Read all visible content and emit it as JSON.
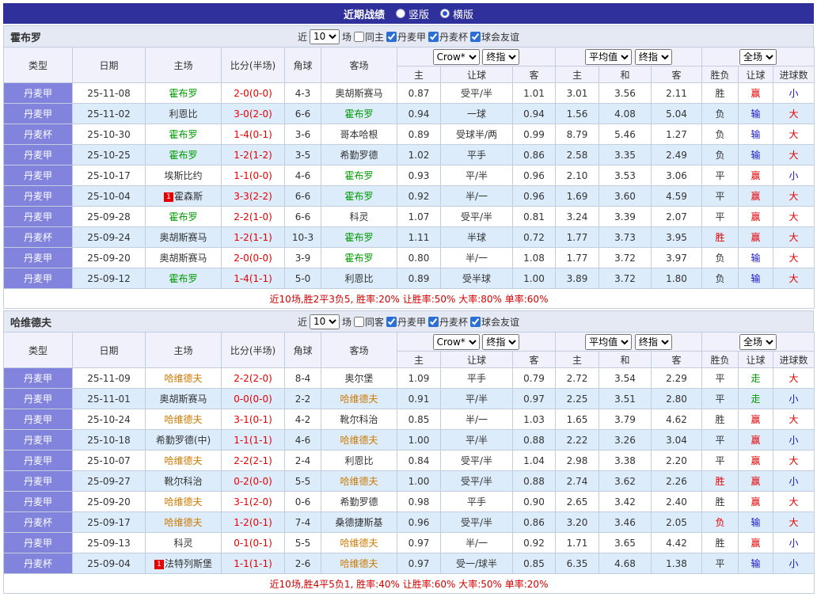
{
  "topbar": {
    "title": "近期战绩",
    "radios": [
      {
        "label": "竖版",
        "selected": false
      },
      {
        "label": "横版",
        "selected": true
      }
    ]
  },
  "filter_labels": {
    "near": "近",
    "games": "场"
  },
  "columns": {
    "type": "类型",
    "date": "日期",
    "home": "主场",
    "score": "比分(半场)",
    "corner": "角球",
    "away": "客场",
    "odds_group": [
      "Crow*",
      "终指"
    ],
    "avg_group": [
      "平均值",
      "终指"
    ],
    "full_group": [
      "全场"
    ],
    "sub": [
      "主",
      "让球",
      "客",
      "主",
      "和",
      "客",
      "胜负",
      "让球",
      "进球数"
    ]
  },
  "colors": {
    "topbar_bg": "#30309c",
    "type_cell_bg": "#8183dc",
    "row_alt_bg": "#dcecfb",
    "focal_team_1": "#009900",
    "focal_team_2": "#cc7a00",
    "score_red": "#e60000",
    "result_win_red": "#e60000",
    "result_lose_blue": "#1717cc",
    "result_push_green": "#009900"
  },
  "sections": [
    {
      "team": "霍布罗",
      "filter": {
        "count": "10",
        "same": {
          "label": "同主",
          "checked": false
        },
        "leagues": [
          {
            "label": "丹麦甲",
            "checked": true
          },
          {
            "label": "丹麦杯",
            "checked": true
          },
          {
            "label": "球会友谊",
            "checked": true
          }
        ]
      },
      "rows": [
        {
          "type": "丹麦甲",
          "date": "25-11-08",
          "home": "霍布罗",
          "hs": "g",
          "hb": "",
          "score": "2-0(0-0)",
          "corner": "4-3",
          "away": "奥胡斯赛马",
          "aws": "p",
          "awb": "",
          "o": [
            "0.87",
            "受平/半",
            "1.01"
          ],
          "m": [
            "3.01",
            "3.56",
            "2.11"
          ],
          "r": [
            [
              "胜",
              "d"
            ],
            [
              "赢",
              "r"
            ],
            [
              "小",
              "b"
            ]
          ]
        },
        {
          "type": "丹麦甲",
          "date": "25-11-02",
          "home": "利恩比",
          "hs": "p",
          "hb": "",
          "score": "3-0(2-0)",
          "corner": "6-6",
          "away": "霍布罗",
          "aws": "g",
          "awb": "",
          "o": [
            "0.94",
            "一球",
            "0.94"
          ],
          "m": [
            "1.56",
            "4.08",
            "5.04"
          ],
          "r": [
            [
              "负",
              "d"
            ],
            [
              "输",
              "b"
            ],
            [
              "大",
              "r"
            ]
          ]
        },
        {
          "type": "丹麦杯",
          "date": "25-10-30",
          "home": "霍布罗",
          "hs": "g",
          "hb": "",
          "score": "1-4(0-1)",
          "corner": "3-6",
          "away": "哥本哈根",
          "aws": "p",
          "awb": "",
          "o": [
            "0.89",
            "受球半/两",
            "0.99"
          ],
          "m": [
            "8.79",
            "5.46",
            "1.27"
          ],
          "r": [
            [
              "负",
              "d"
            ],
            [
              "输",
              "b"
            ],
            [
              "大",
              "r"
            ]
          ]
        },
        {
          "type": "丹麦甲",
          "date": "25-10-25",
          "home": "霍布罗",
          "hs": "g",
          "hb": "",
          "score": "1-2(1-2)",
          "corner": "3-5",
          "away": "希勤罗德",
          "aws": "p",
          "awb": "",
          "o": [
            "1.02",
            "平手",
            "0.86"
          ],
          "m": [
            "2.58",
            "3.35",
            "2.49"
          ],
          "r": [
            [
              "负",
              "d"
            ],
            [
              "输",
              "b"
            ],
            [
              "大",
              "r"
            ]
          ]
        },
        {
          "type": "丹麦甲",
          "date": "25-10-17",
          "home": "埃斯比约",
          "hs": "p",
          "hb": "",
          "score": "1-1(0-0)",
          "corner": "4-6",
          "away": "霍布罗",
          "aws": "g",
          "awb": "",
          "o": [
            "0.93",
            "平/半",
            "0.96"
          ],
          "m": [
            "2.10",
            "3.53",
            "3.06"
          ],
          "r": [
            [
              "平",
              "d"
            ],
            [
              "赢",
              "r"
            ],
            [
              "小",
              "b"
            ]
          ]
        },
        {
          "type": "丹麦甲",
          "date": "25-10-04",
          "home": "霍森斯",
          "hs": "p",
          "hb": "1",
          "score": "3-3(2-2)",
          "corner": "6-6",
          "away": "霍布罗",
          "aws": "g",
          "awb": "",
          "o": [
            "0.92",
            "半/一",
            "0.96"
          ],
          "m": [
            "1.69",
            "3.60",
            "4.59"
          ],
          "r": [
            [
              "平",
              "d"
            ],
            [
              "赢",
              "r"
            ],
            [
              "大",
              "r"
            ]
          ]
        },
        {
          "type": "丹麦甲",
          "date": "25-09-28",
          "home": "霍布罗",
          "hs": "g",
          "hb": "",
          "score": "2-2(1-0)",
          "corner": "6-6",
          "away": "科灵",
          "aws": "p",
          "awb": "",
          "o": [
            "1.07",
            "受平/半",
            "0.81"
          ],
          "m": [
            "3.24",
            "3.39",
            "2.07"
          ],
          "r": [
            [
              "平",
              "d"
            ],
            [
              "赢",
              "r"
            ],
            [
              "大",
              "r"
            ]
          ]
        },
        {
          "type": "丹麦杯",
          "date": "25-09-24",
          "home": "奥胡斯赛马",
          "hs": "p",
          "hb": "",
          "score": "1-2(1-1)",
          "corner": "10-3",
          "away": "霍布罗",
          "aws": "g",
          "awb": "",
          "o": [
            "1.11",
            "半球",
            "0.72"
          ],
          "m": [
            "1.77",
            "3.73",
            "3.95"
          ],
          "r": [
            [
              "胜",
              "r"
            ],
            [
              "赢",
              "r"
            ],
            [
              "大",
              "r"
            ]
          ]
        },
        {
          "type": "丹麦甲",
          "date": "25-09-20",
          "home": "奥胡斯赛马",
          "hs": "p",
          "hb": "",
          "score": "2-0(0-0)",
          "corner": "3-9",
          "away": "霍布罗",
          "aws": "g",
          "awb": "",
          "o": [
            "0.80",
            "半/一",
            "1.08"
          ],
          "m": [
            "1.77",
            "3.72",
            "3.97"
          ],
          "r": [
            [
              "负",
              "d"
            ],
            [
              "输",
              "b"
            ],
            [
              "大",
              "r"
            ]
          ]
        },
        {
          "type": "丹麦甲",
          "date": "25-09-12",
          "home": "霍布罗",
          "hs": "g",
          "hb": "",
          "score": "1-4(1-1)",
          "corner": "5-0",
          "away": "利恩比",
          "aws": "p",
          "awb": "",
          "o": [
            "0.89",
            "受半球",
            "1.00"
          ],
          "m": [
            "3.89",
            "3.72",
            "1.80"
          ],
          "r": [
            [
              "负",
              "d"
            ],
            [
              "输",
              "b"
            ],
            [
              "大",
              "r"
            ]
          ]
        }
      ],
      "summary": "近10场,胜2平3负5, 胜率:20% 让胜率:50% 大率:80% 单率:60%"
    },
    {
      "team": "哈维德夫",
      "filter": {
        "count": "10",
        "same": {
          "label": "同客",
          "checked": false
        },
        "leagues": [
          {
            "label": "丹麦甲",
            "checked": true
          },
          {
            "label": "丹麦杯",
            "checked": true
          },
          {
            "label": "球会友谊",
            "checked": true
          }
        ]
      },
      "rows": [
        {
          "type": "丹麦甲",
          "date": "25-11-09",
          "home": "哈维德夫",
          "hs": "o",
          "hb": "",
          "score": "2-2(2-0)",
          "corner": "8-4",
          "away": "奥尔堡",
          "aws": "p",
          "awb": "",
          "o": [
            "1.09",
            "平手",
            "0.79"
          ],
          "m": [
            "2.72",
            "3.54",
            "2.29"
          ],
          "r": [
            [
              "平",
              "d"
            ],
            [
              "走",
              "gn"
            ],
            [
              "大",
              "r"
            ]
          ]
        },
        {
          "type": "丹麦甲",
          "date": "25-11-01",
          "home": "奥胡斯赛马",
          "hs": "p",
          "hb": "",
          "score": "0-0(0-0)",
          "corner": "2-2",
          "away": "哈维德夫",
          "aws": "o",
          "awb": "",
          "o": [
            "0.91",
            "平/半",
            "0.97"
          ],
          "m": [
            "2.25",
            "3.51",
            "2.80"
          ],
          "r": [
            [
              "平",
              "d"
            ],
            [
              "走",
              "gn"
            ],
            [
              "小",
              "b"
            ]
          ]
        },
        {
          "type": "丹麦甲",
          "date": "25-10-24",
          "home": "哈维德夫",
          "hs": "o",
          "hb": "",
          "score": "3-1(0-1)",
          "corner": "4-2",
          "away": "靴尔科治",
          "aws": "p",
          "awb": "",
          "o": [
            "0.85",
            "半/一",
            "1.03"
          ],
          "m": [
            "1.65",
            "3.79",
            "4.62"
          ],
          "r": [
            [
              "胜",
              "d"
            ],
            [
              "赢",
              "r"
            ],
            [
              "大",
              "r"
            ]
          ]
        },
        {
          "type": "丹麦甲",
          "date": "25-10-18",
          "home": "希勤罗德(中)",
          "hs": "p",
          "hb": "",
          "score": "1-1(1-1)",
          "corner": "4-6",
          "away": "哈维德夫",
          "aws": "o",
          "awb": "",
          "o": [
            "1.00",
            "平/半",
            "0.88"
          ],
          "m": [
            "2.22",
            "3.26",
            "3.04"
          ],
          "r": [
            [
              "平",
              "d"
            ],
            [
              "赢",
              "r"
            ],
            [
              "小",
              "b"
            ]
          ]
        },
        {
          "type": "丹麦甲",
          "date": "25-10-07",
          "home": "哈维德夫",
          "hs": "o",
          "hb": "",
          "score": "2-2(2-1)",
          "corner": "2-4",
          "away": "利恩比",
          "aws": "p",
          "awb": "",
          "o": [
            "0.84",
            "受平/半",
            "1.04"
          ],
          "m": [
            "2.98",
            "3.38",
            "2.20"
          ],
          "r": [
            [
              "平",
              "d"
            ],
            [
              "赢",
              "r"
            ],
            [
              "大",
              "r"
            ]
          ]
        },
        {
          "type": "丹麦甲",
          "date": "25-09-27",
          "home": "靴尔科治",
          "hs": "p",
          "hb": "",
          "score": "0-2(0-0)",
          "corner": "5-5",
          "away": "哈维德夫",
          "aws": "o",
          "awb": "",
          "o": [
            "1.00",
            "受平/半",
            "0.88"
          ],
          "m": [
            "2.74",
            "3.62",
            "2.26"
          ],
          "r": [
            [
              "胜",
              "r"
            ],
            [
              "赢",
              "r"
            ],
            [
              "小",
              "b"
            ]
          ]
        },
        {
          "type": "丹麦甲",
          "date": "25-09-20",
          "home": "哈维德夫",
          "hs": "o",
          "hb": "",
          "score": "3-1(2-0)",
          "corner": "0-6",
          "away": "希勤罗德",
          "aws": "p",
          "awb": "",
          "o": [
            "0.98",
            "平手",
            "0.90"
          ],
          "m": [
            "2.65",
            "3.42",
            "2.40"
          ],
          "r": [
            [
              "胜",
              "d"
            ],
            [
              "赢",
              "r"
            ],
            [
              "大",
              "r"
            ]
          ]
        },
        {
          "type": "丹麦杯",
          "date": "25-09-17",
          "home": "哈维德夫",
          "hs": "o",
          "hb": "",
          "score": "1-2(0-1)",
          "corner": "7-4",
          "away": "桑德捷斯基",
          "aws": "p",
          "awb": "",
          "o": [
            "0.96",
            "受平/半",
            "0.86"
          ],
          "m": [
            "3.20",
            "3.46",
            "2.05"
          ],
          "r": [
            [
              "负",
              "r"
            ],
            [
              "输",
              "b"
            ],
            [
              "大",
              "r"
            ]
          ]
        },
        {
          "type": "丹麦甲",
          "date": "25-09-13",
          "home": "科灵",
          "hs": "p",
          "hb": "",
          "score": "0-1(0-1)",
          "corner": "5-5",
          "away": "哈维德夫",
          "aws": "o",
          "awb": "",
          "o": [
            "0.97",
            "半/一",
            "0.92"
          ],
          "m": [
            "1.71",
            "3.65",
            "4.42"
          ],
          "r": [
            [
              "胜",
              "d"
            ],
            [
              "赢",
              "r"
            ],
            [
              "小",
              "b"
            ]
          ]
        },
        {
          "type": "丹麦杯",
          "date": "25-09-04",
          "home": "法特列斯堡",
          "hs": "p",
          "hb": "1",
          "score": "1-1(1-1)",
          "corner": "2-6",
          "away": "哈维德夫",
          "aws": "o",
          "awb": "",
          "o": [
            "0.97",
            "受一/球半",
            "0.85"
          ],
          "m": [
            "6.35",
            "4.68",
            "1.38"
          ],
          "r": [
            [
              "平",
              "d"
            ],
            [
              "输",
              "b"
            ],
            [
              "小",
              "b"
            ]
          ]
        }
      ],
      "summary": "近10场,胜4平5负1, 胜率:40% 让胜率:60% 大率:50% 单率:20%"
    }
  ]
}
